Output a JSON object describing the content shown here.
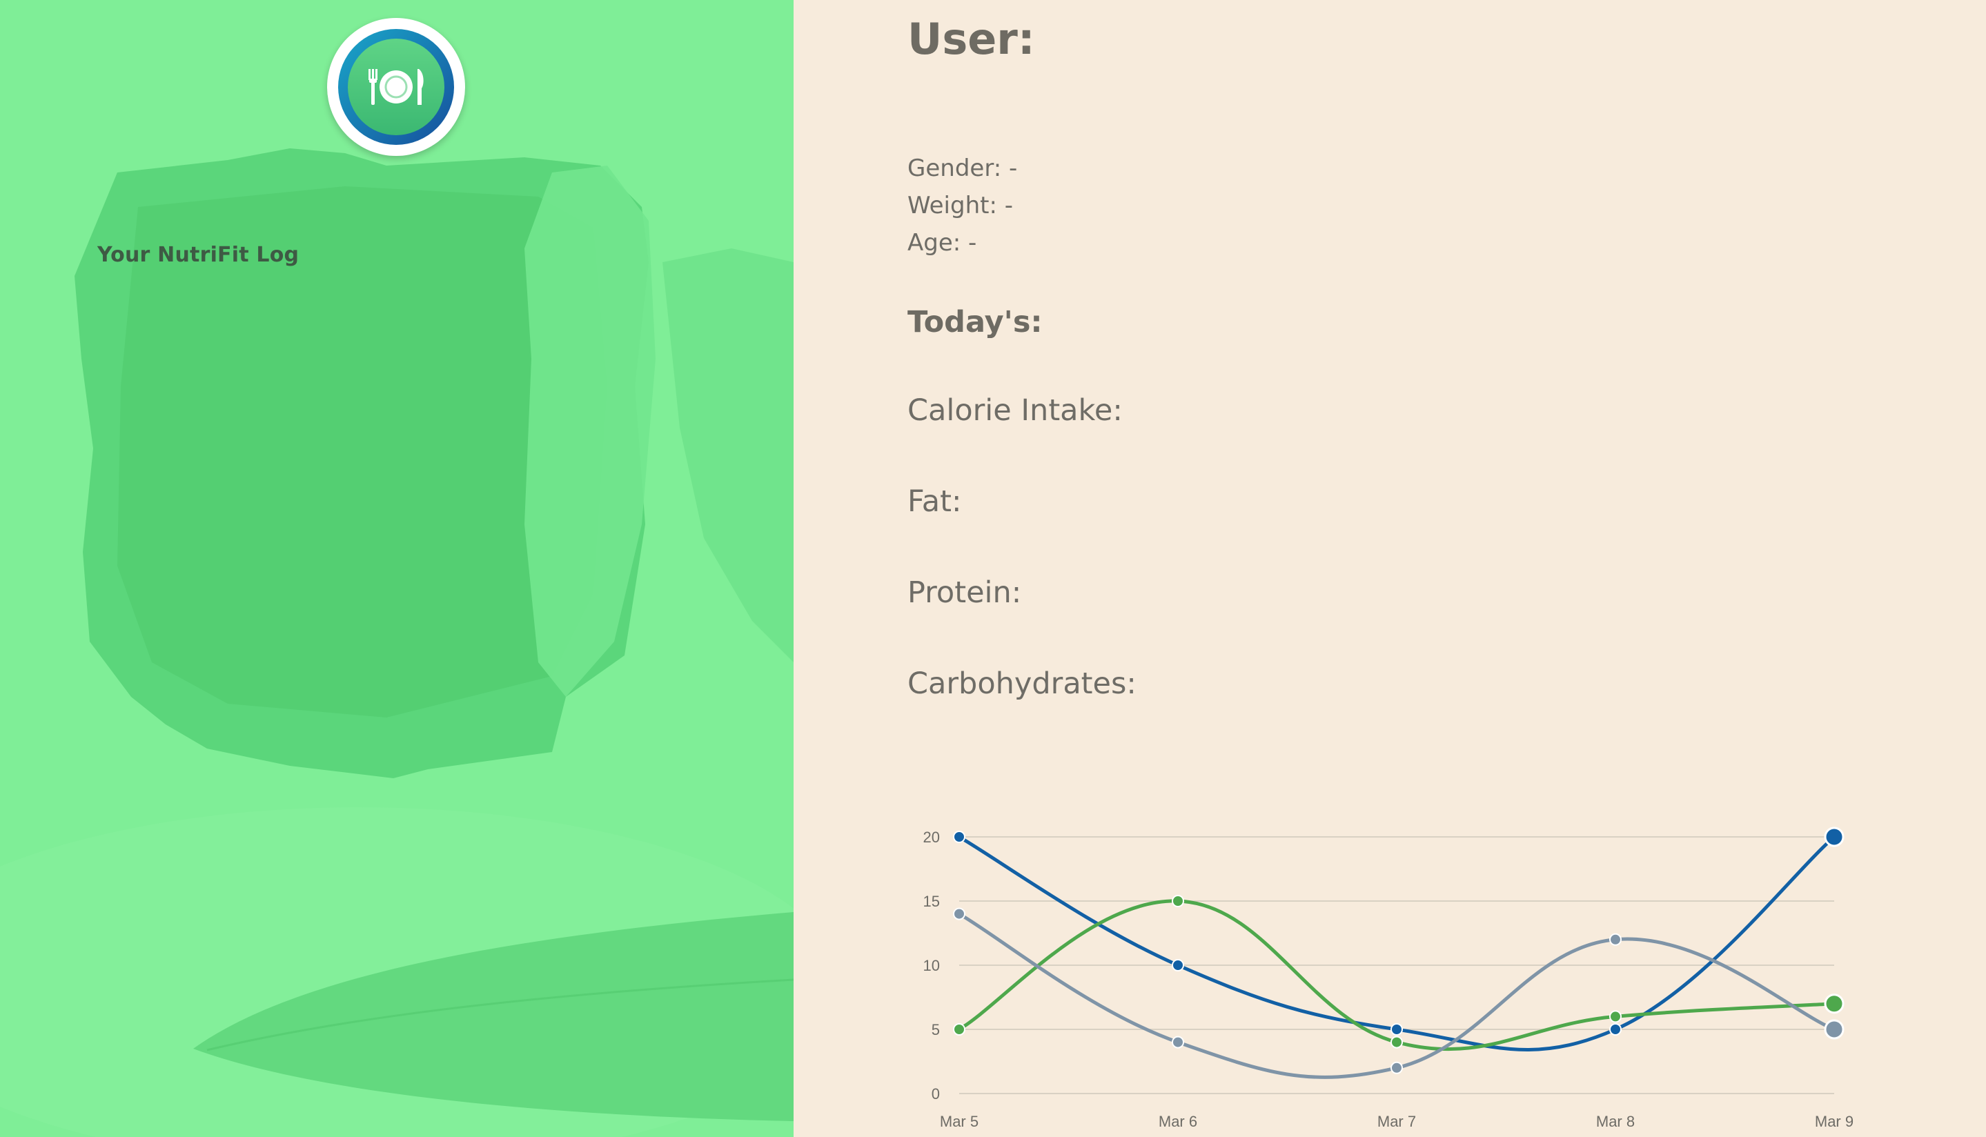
{
  "sidebar": {
    "brand": "Your NutriFit Log",
    "logo_icon": "plate-fork-knife-icon",
    "background_color": "#7fee97"
  },
  "profile": {
    "title": "User:",
    "gender_label": "Gender:",
    "gender_value": "-",
    "weight_label": "Weight:",
    "weight_value": "-",
    "age_label": "Age:",
    "age_value": "-"
  },
  "today": {
    "title": "Today's:",
    "calorie_label": "Calorie Intake:",
    "fat_label": "Fat:",
    "protein_label": "Protein:",
    "carbs_label": "Carbohydrates:"
  },
  "colors": {
    "panel_background": "#f7ebdc",
    "text": "#6e6c66"
  },
  "chart_data": {
    "type": "line",
    "categories": [
      "Mar 5",
      "Mar 6",
      "Mar 7",
      "Mar 8",
      "Mar 9"
    ],
    "ylim": [
      0,
      20
    ],
    "yticks": [
      0,
      5,
      10,
      15,
      20
    ],
    "grid": true,
    "series": [
      {
        "color": "#1260a5",
        "values": [
          20,
          10,
          5,
          5,
          20
        ]
      },
      {
        "color": "#4ea84c",
        "values": [
          5,
          15,
          4,
          6,
          7
        ]
      },
      {
        "color": "#7f94a7",
        "values": [
          14,
          4,
          2,
          12,
          5
        ]
      }
    ]
  }
}
